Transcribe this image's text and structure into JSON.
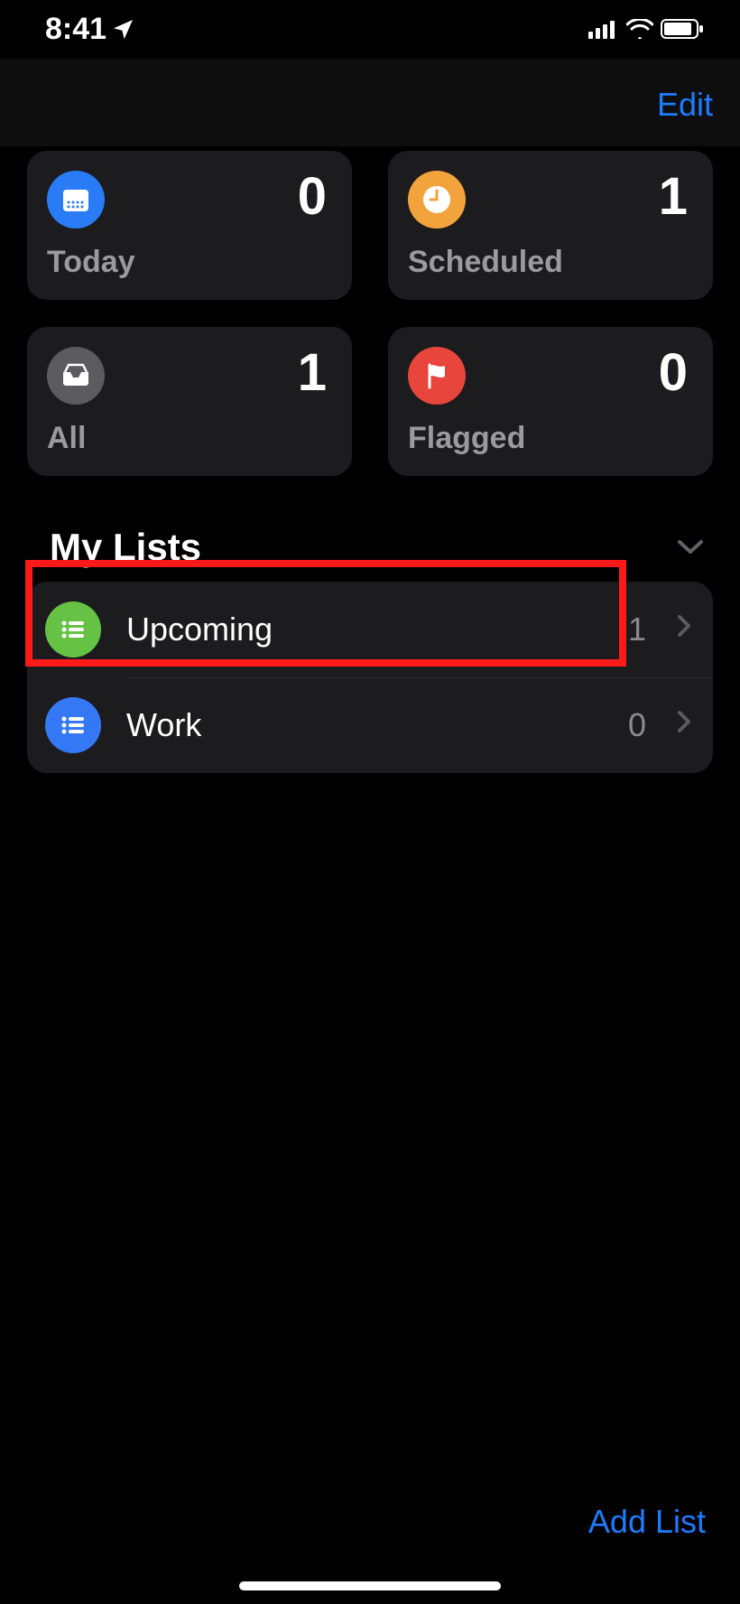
{
  "status": {
    "time": "8:41"
  },
  "header": {
    "edit_label": "Edit"
  },
  "cards": [
    {
      "icon": "calendar-icon",
      "label": "Today",
      "count": "0",
      "color": "bg-blue"
    },
    {
      "icon": "clock-icon",
      "label": "Scheduled",
      "count": "1",
      "color": "bg-orange"
    },
    {
      "icon": "tray-icon",
      "label": "All",
      "count": "1",
      "color": "bg-gray"
    },
    {
      "icon": "flag-icon",
      "label": "Flagged",
      "count": "0",
      "color": "bg-red"
    }
  ],
  "section": {
    "title": "My Lists"
  },
  "lists": [
    {
      "icon": "list-icon",
      "name": "Upcoming",
      "count": "1",
      "color": "bg-green"
    },
    {
      "icon": "list-icon",
      "name": "Work",
      "count": "0",
      "color": "bg-blue2"
    }
  ],
  "footer": {
    "add_list_label": "Add List"
  }
}
